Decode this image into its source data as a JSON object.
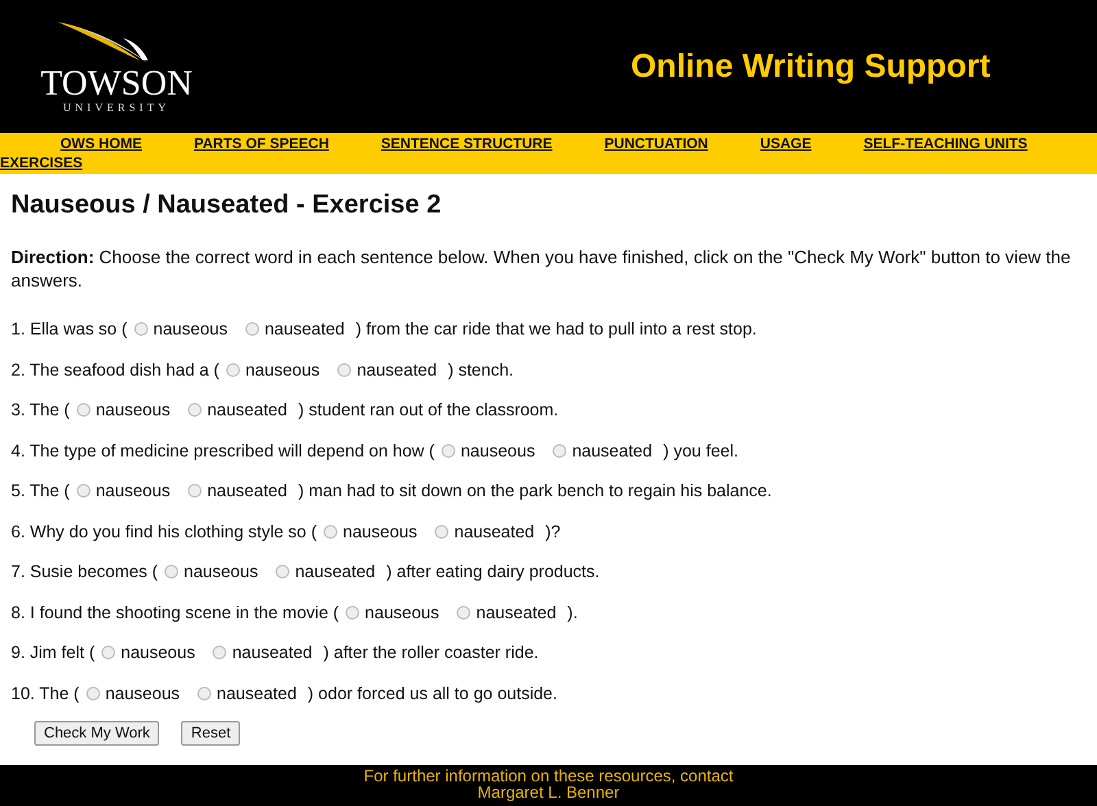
{
  "header": {
    "logo_name": "TOWSON",
    "logo_sub": "UNIVERSITY",
    "site_title": "Online Writing Support"
  },
  "nav": [
    "OWS HOME",
    "PARTS OF SPEECH",
    "SENTENCE STRUCTURE",
    "PUNCTUATION",
    "USAGE",
    "SELF-TEACHING UNITS",
    "EXERCISES"
  ],
  "title": "Nauseous / Nauseated - Exercise 2",
  "direction": {
    "label": "Direction:",
    "text": "Choose the correct word in each sentence below. When you have finished, click on the \"Check My Work\" button to view the answers."
  },
  "questions": [
    {
      "before": "1. Ella was so (",
      "options": [
        {
          "label": "nauseous",
          "selected": false
        },
        {
          "label": "nauseated",
          "selected": false
        }
      ],
      "after": ") from the car ride that we had to pull into a rest stop."
    },
    {
      "before": "2. The seafood dish had a (",
      "options": [
        {
          "label": "nauseous",
          "selected": false
        },
        {
          "label": "nauseated",
          "selected": false
        }
      ],
      "after": ") stench."
    },
    {
      "before": "3. The (",
      "options": [
        {
          "label": "nauseous",
          "selected": false
        },
        {
          "label": "nauseated",
          "selected": false
        }
      ],
      "after": ") student ran out of the classroom."
    },
    {
      "before": "4. The type of medicine prescribed will depend on how (",
      "options": [
        {
          "label": "nauseous",
          "selected": false
        },
        {
          "label": "nauseated",
          "selected": false
        }
      ],
      "after": ") you feel."
    },
    {
      "before": "5. The (",
      "options": [
        {
          "label": "nauseous",
          "selected": false
        },
        {
          "label": "nauseated",
          "selected": false
        }
      ],
      "after": ") man had to sit down on the park bench to regain his balance."
    },
    {
      "before": "6. Why do you find his clothing style so (",
      "options": [
        {
          "label": "nauseous",
          "selected": false
        },
        {
          "label": "nauseated",
          "selected": false
        }
      ],
      "after": ")?"
    },
    {
      "before": "7. Susie becomes (",
      "options": [
        {
          "label": "nauseous",
          "selected": false
        },
        {
          "label": "nauseated",
          "selected": false
        }
      ],
      "after": ") after eating dairy products."
    },
    {
      "before": "8. I found the shooting scene in the movie (",
      "options": [
        {
          "label": "nauseous",
          "selected": false
        },
        {
          "label": "nauseated",
          "selected": false
        }
      ],
      "after": ")."
    },
    {
      "before": "9. Jim felt (",
      "options": [
        {
          "label": "nauseous",
          "selected": false
        },
        {
          "label": "nauseated",
          "selected": false
        }
      ],
      "after": ") after the roller coaster ride."
    },
    {
      "before": "10. The (",
      "options": [
        {
          "label": "nauseous",
          "selected": false
        },
        {
          "label": "nauseated",
          "selected": false
        }
      ],
      "after": ") odor forced us all to go outside."
    }
  ],
  "buttons": [
    "Check My Work",
    "Reset"
  ],
  "footer": [
    "For further information on these resources, contact",
    "Margaret L. Benner"
  ]
}
